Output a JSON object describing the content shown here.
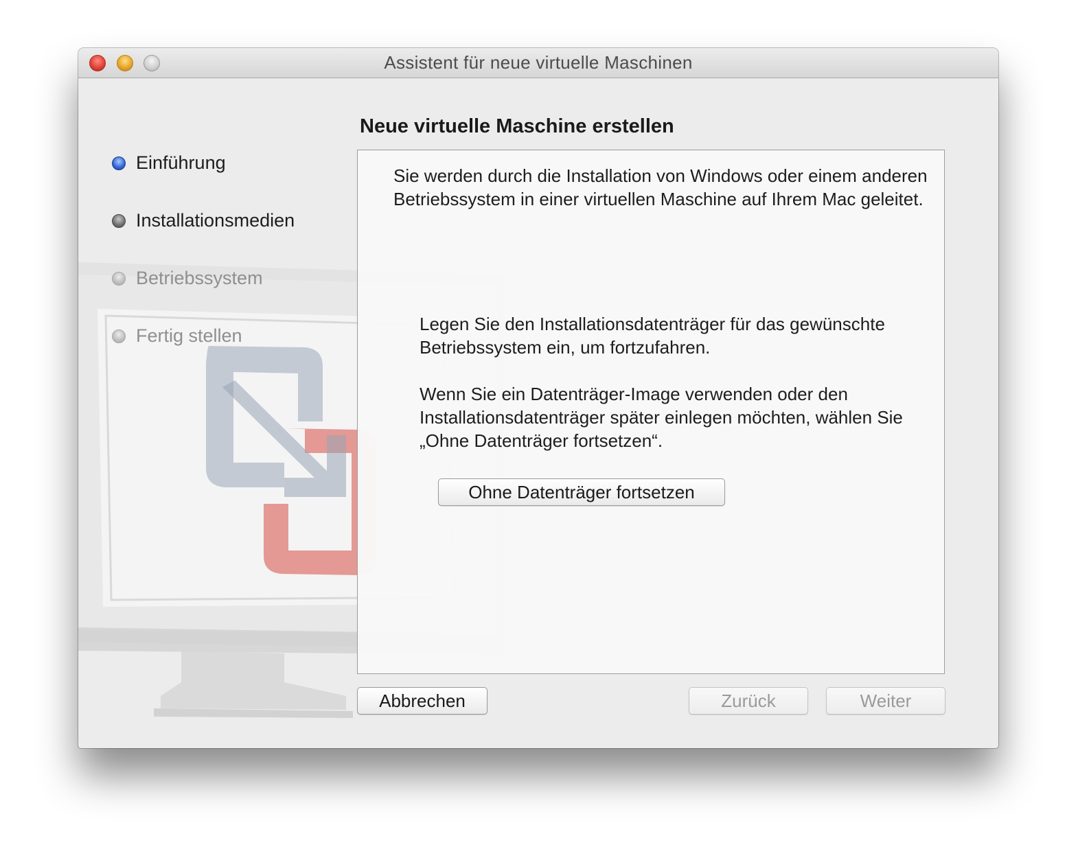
{
  "window": {
    "title": "Assistent für neue virtuelle Maschinen"
  },
  "steps": [
    {
      "label": "Einführung",
      "state": "active"
    },
    {
      "label": "Installationsmedien",
      "state": "pending"
    },
    {
      "label": "Betriebssystem",
      "state": "disabled"
    },
    {
      "label": "Fertig stellen",
      "state": "disabled"
    }
  ],
  "main": {
    "heading": "Neue virtuelle Maschine erstellen",
    "intro": "Sie werden durch die Installation von Windows oder einem anderen Betriebssystem in einer virtuellen Maschine auf Ihrem Mac geleitet.",
    "insert_text": "Legen Sie den Installationsdatenträger für das gewünschte Betriebssystem ein, um fortzufahren.",
    "image_text": "Wenn Sie ein Datenträger-Image verwenden oder den Installationsdatenträger später einlegen möchten, wählen Sie „Ohne Datenträger fortsetzen“.",
    "continue_button": "Ohne Datenträger fortsetzen"
  },
  "footer": {
    "cancel": "Abbrechen",
    "back": "Zurück",
    "next": "Weiter"
  },
  "colors": {
    "active_step": "#2f64d6",
    "window_background": "#ececec"
  }
}
